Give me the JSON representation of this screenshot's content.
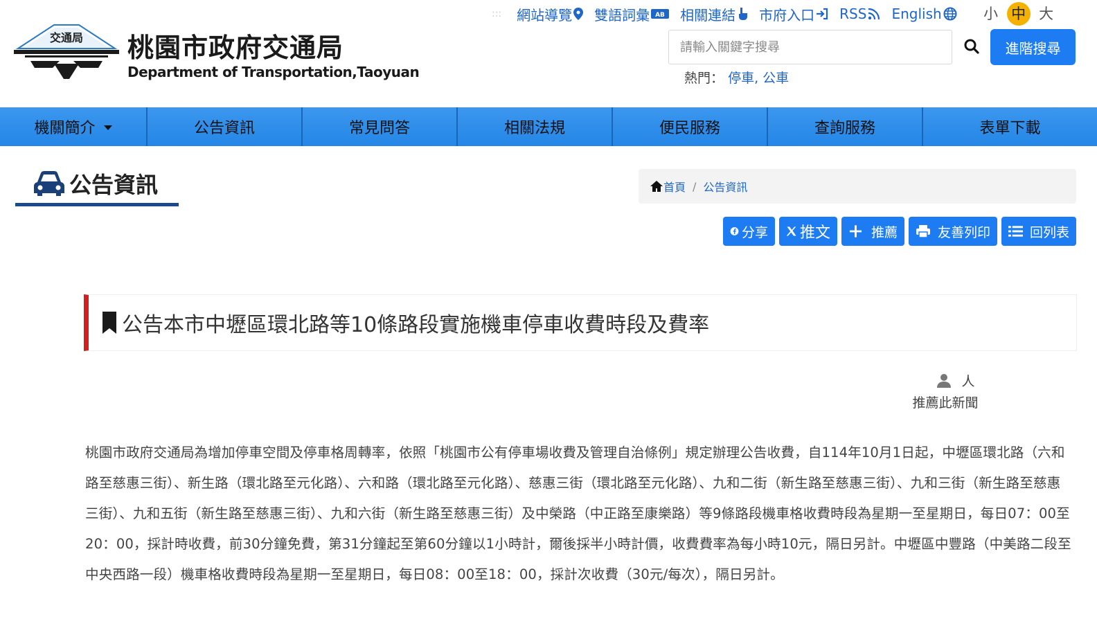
{
  "header": {
    "site_title": "桃園市政府交通局",
    "site_subtitle": "Department of Transportation,Taoyuan",
    "logo_text": "交通局",
    "top_links": [
      {
        "label": "網站導覽",
        "icon": "map-marker-icon"
      },
      {
        "label": "雙語詞彙",
        "icon": "dictionary-icon"
      },
      {
        "label": "相關連結",
        "icon": "pointer-hand-icon"
      },
      {
        "label": "市府入口",
        "icon": "sign-in-icon"
      },
      {
        "label": "RSS",
        "icon": "rss-icon"
      },
      {
        "label": "English",
        "icon": "globe-icon"
      }
    ],
    "font_sizes": {
      "small": "小",
      "medium": "中",
      "large": "大",
      "active": "medium"
    },
    "search": {
      "placeholder": "請輸入關鍵字搜尋",
      "advanced_label": "進階搜尋"
    },
    "hot": {
      "label": "熱門：",
      "items": [
        "停車",
        "公車"
      ],
      "separator": ", "
    }
  },
  "nav": {
    "items": [
      {
        "label": "機關簡介",
        "has_dropdown": true
      },
      {
        "label": "公告資訊"
      },
      {
        "label": "常見問答"
      },
      {
        "label": "相關法規"
      },
      {
        "label": "便民服務"
      },
      {
        "label": "查詢服務"
      },
      {
        "label": "表單下載"
      }
    ],
    "color": "#2486e6"
  },
  "section": {
    "title": "公告資訊",
    "icon": "car-icon"
  },
  "breadcrumb": {
    "home": "首頁",
    "separator": "/",
    "current": "公告資訊"
  },
  "actions": [
    {
      "label": "分享",
      "icon": "facebook-icon"
    },
    {
      "label": "推文",
      "icon": "x-icon"
    },
    {
      "label": "推薦",
      "icon": "plus-icon"
    },
    {
      "label": "友善列印",
      "icon": "print-icon"
    },
    {
      "label": "回列表",
      "icon": "list-icon"
    }
  ],
  "article": {
    "title": "公告本市中壢區環北路等10條路段實施機車停車收費時段及費率",
    "recommend": {
      "count_suffix": "人",
      "label": "推薦此新聞"
    },
    "body": "桃園市政府交通局為增加停車空間及停車格周轉率，依照「桃園市公有停車場收費及管理自治條例」規定辦理公告收費，自114年10月1日起，中壢區環北路（六和路至慈惠三街）、新生路（環北路至元化路）、六和路（環北路至元化路）、慈惠三街（環北路至元化路）、九和二街（新生路至慈惠三街）、九和三街（新生路至慈惠三街）、九和五街（新生路至慈惠三街）、九和六街（新生路至慈惠三街）及中榮路（中正路至康樂路）等9條路段機車格收費時段為星期一至星期日，每日07：00至20：00，採計時收費，前30分鐘免費，第31分鐘起至第60分鐘以1小時計，爾後採半小時計價，收費費率為每小時10元，隔日另計。中壢區中豐路（中美路二段至中央西路一段）機車格收費時段為星期一至星期日，每日08：00至18：00，採計次收費（30元/每次），隔日另計。"
  },
  "colors": {
    "accent_blue": "#1d7cf2",
    "link_blue": "#1e66c8",
    "title_bar_red": "#d02020",
    "section_underline": "#1b4a8c",
    "active_font": "#f5b100"
  }
}
